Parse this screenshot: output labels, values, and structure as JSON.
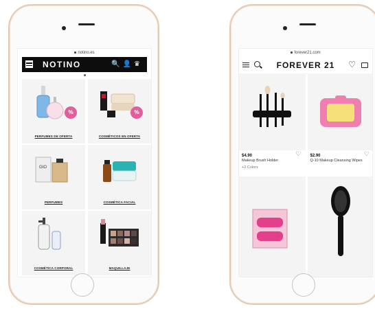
{
  "notino": {
    "url": "notino.es",
    "brand": "NOTINO",
    "icons": [
      "menu-icon",
      "search-icon",
      "user-icon",
      "crown-icon"
    ],
    "categories": [
      {
        "label": "PERFUMES DE OFERTA",
        "badge": "%"
      },
      {
        "label": "COSMÉTICOS EN OFERTA",
        "badge": "%"
      },
      {
        "label": "PERFUMES"
      },
      {
        "label": "COSMÉTICA FACIAL"
      },
      {
        "label": "COSMÉTICA CORPORAL"
      },
      {
        "label": "MAQUILLAJE"
      }
    ],
    "colors": {
      "bar": "#0d0d0d",
      "badge": "#e35d9c"
    }
  },
  "forever21": {
    "url": "forever21.com",
    "brand": "FOREVER 21",
    "icons": [
      "menu-icon",
      "search-icon",
      "heart-icon",
      "bag-icon"
    ],
    "products": [
      {
        "price": "$4.90",
        "name": "Makeup Brush Holder",
        "colors": "+2 Colors"
      },
      {
        "price": "$2.90",
        "name": "Q-10 Makeup Cleansing Wipes"
      },
      {},
      {}
    ]
  }
}
